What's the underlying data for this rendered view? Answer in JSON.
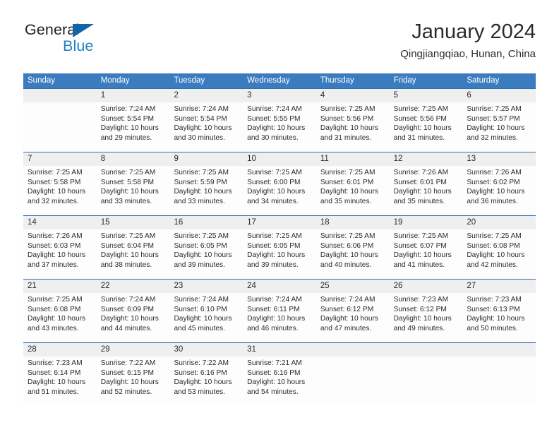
{
  "brand": {
    "name_part1": "General",
    "name_part2": "Blue",
    "triangle_color": "#1164a8",
    "blue_color": "#1f7fc4"
  },
  "header": {
    "title": "January 2024",
    "location": "Qingjiangqiao, Hunan, China"
  },
  "theme": {
    "header_row_bg": "#3a7cbe",
    "week_divider": "#2f6fae",
    "number_band_bg": "#efefef"
  },
  "weekdays": [
    "Sunday",
    "Monday",
    "Tuesday",
    "Wednesday",
    "Thursday",
    "Friday",
    "Saturday"
  ],
  "weeks": [
    {
      "days": [
        {
          "num": "",
          "l1": "",
          "l2": "",
          "l3": "",
          "l4": ""
        },
        {
          "num": "1",
          "l1": "Sunrise: 7:24 AM",
          "l2": "Sunset: 5:54 PM",
          "l3": "Daylight: 10 hours",
          "l4": "and 29 minutes."
        },
        {
          "num": "2",
          "l1": "Sunrise: 7:24 AM",
          "l2": "Sunset: 5:54 PM",
          "l3": "Daylight: 10 hours",
          "l4": "and 30 minutes."
        },
        {
          "num": "3",
          "l1": "Sunrise: 7:24 AM",
          "l2": "Sunset: 5:55 PM",
          "l3": "Daylight: 10 hours",
          "l4": "and 30 minutes."
        },
        {
          "num": "4",
          "l1": "Sunrise: 7:25 AM",
          "l2": "Sunset: 5:56 PM",
          "l3": "Daylight: 10 hours",
          "l4": "and 31 minutes."
        },
        {
          "num": "5",
          "l1": "Sunrise: 7:25 AM",
          "l2": "Sunset: 5:56 PM",
          "l3": "Daylight: 10 hours",
          "l4": "and 31 minutes."
        },
        {
          "num": "6",
          "l1": "Sunrise: 7:25 AM",
          "l2": "Sunset: 5:57 PM",
          "l3": "Daylight: 10 hours",
          "l4": "and 32 minutes."
        }
      ]
    },
    {
      "days": [
        {
          "num": "7",
          "l1": "Sunrise: 7:25 AM",
          "l2": "Sunset: 5:58 PM",
          "l3": "Daylight: 10 hours",
          "l4": "and 32 minutes."
        },
        {
          "num": "8",
          "l1": "Sunrise: 7:25 AM",
          "l2": "Sunset: 5:58 PM",
          "l3": "Daylight: 10 hours",
          "l4": "and 33 minutes."
        },
        {
          "num": "9",
          "l1": "Sunrise: 7:25 AM",
          "l2": "Sunset: 5:59 PM",
          "l3": "Daylight: 10 hours",
          "l4": "and 33 minutes."
        },
        {
          "num": "10",
          "l1": "Sunrise: 7:25 AM",
          "l2": "Sunset: 6:00 PM",
          "l3": "Daylight: 10 hours",
          "l4": "and 34 minutes."
        },
        {
          "num": "11",
          "l1": "Sunrise: 7:25 AM",
          "l2": "Sunset: 6:01 PM",
          "l3": "Daylight: 10 hours",
          "l4": "and 35 minutes."
        },
        {
          "num": "12",
          "l1": "Sunrise: 7:26 AM",
          "l2": "Sunset: 6:01 PM",
          "l3": "Daylight: 10 hours",
          "l4": "and 35 minutes."
        },
        {
          "num": "13",
          "l1": "Sunrise: 7:26 AM",
          "l2": "Sunset: 6:02 PM",
          "l3": "Daylight: 10 hours",
          "l4": "and 36 minutes."
        }
      ]
    },
    {
      "days": [
        {
          "num": "14",
          "l1": "Sunrise: 7:26 AM",
          "l2": "Sunset: 6:03 PM",
          "l3": "Daylight: 10 hours",
          "l4": "and 37 minutes."
        },
        {
          "num": "15",
          "l1": "Sunrise: 7:25 AM",
          "l2": "Sunset: 6:04 PM",
          "l3": "Daylight: 10 hours",
          "l4": "and 38 minutes."
        },
        {
          "num": "16",
          "l1": "Sunrise: 7:25 AM",
          "l2": "Sunset: 6:05 PM",
          "l3": "Daylight: 10 hours",
          "l4": "and 39 minutes."
        },
        {
          "num": "17",
          "l1": "Sunrise: 7:25 AM",
          "l2": "Sunset: 6:05 PM",
          "l3": "Daylight: 10 hours",
          "l4": "and 39 minutes."
        },
        {
          "num": "18",
          "l1": "Sunrise: 7:25 AM",
          "l2": "Sunset: 6:06 PM",
          "l3": "Daylight: 10 hours",
          "l4": "and 40 minutes."
        },
        {
          "num": "19",
          "l1": "Sunrise: 7:25 AM",
          "l2": "Sunset: 6:07 PM",
          "l3": "Daylight: 10 hours",
          "l4": "and 41 minutes."
        },
        {
          "num": "20",
          "l1": "Sunrise: 7:25 AM",
          "l2": "Sunset: 6:08 PM",
          "l3": "Daylight: 10 hours",
          "l4": "and 42 minutes."
        }
      ]
    },
    {
      "days": [
        {
          "num": "21",
          "l1": "Sunrise: 7:25 AM",
          "l2": "Sunset: 6:08 PM",
          "l3": "Daylight: 10 hours",
          "l4": "and 43 minutes."
        },
        {
          "num": "22",
          "l1": "Sunrise: 7:24 AM",
          "l2": "Sunset: 6:09 PM",
          "l3": "Daylight: 10 hours",
          "l4": "and 44 minutes."
        },
        {
          "num": "23",
          "l1": "Sunrise: 7:24 AM",
          "l2": "Sunset: 6:10 PM",
          "l3": "Daylight: 10 hours",
          "l4": "and 45 minutes."
        },
        {
          "num": "24",
          "l1": "Sunrise: 7:24 AM",
          "l2": "Sunset: 6:11 PM",
          "l3": "Daylight: 10 hours",
          "l4": "and 46 minutes."
        },
        {
          "num": "25",
          "l1": "Sunrise: 7:24 AM",
          "l2": "Sunset: 6:12 PM",
          "l3": "Daylight: 10 hours",
          "l4": "and 47 minutes."
        },
        {
          "num": "26",
          "l1": "Sunrise: 7:23 AM",
          "l2": "Sunset: 6:12 PM",
          "l3": "Daylight: 10 hours",
          "l4": "and 49 minutes."
        },
        {
          "num": "27",
          "l1": "Sunrise: 7:23 AM",
          "l2": "Sunset: 6:13 PM",
          "l3": "Daylight: 10 hours",
          "l4": "and 50 minutes."
        }
      ]
    },
    {
      "days": [
        {
          "num": "28",
          "l1": "Sunrise: 7:23 AM",
          "l2": "Sunset: 6:14 PM",
          "l3": "Daylight: 10 hours",
          "l4": "and 51 minutes."
        },
        {
          "num": "29",
          "l1": "Sunrise: 7:22 AM",
          "l2": "Sunset: 6:15 PM",
          "l3": "Daylight: 10 hours",
          "l4": "and 52 minutes."
        },
        {
          "num": "30",
          "l1": "Sunrise: 7:22 AM",
          "l2": "Sunset: 6:16 PM",
          "l3": "Daylight: 10 hours",
          "l4": "and 53 minutes."
        },
        {
          "num": "31",
          "l1": "Sunrise: 7:21 AM",
          "l2": "Sunset: 6:16 PM",
          "l3": "Daylight: 10 hours",
          "l4": "and 54 minutes."
        },
        {
          "num": "",
          "l1": "",
          "l2": "",
          "l3": "",
          "l4": ""
        },
        {
          "num": "",
          "l1": "",
          "l2": "",
          "l3": "",
          "l4": ""
        },
        {
          "num": "",
          "l1": "",
          "l2": "",
          "l3": "",
          "l4": ""
        }
      ]
    }
  ]
}
